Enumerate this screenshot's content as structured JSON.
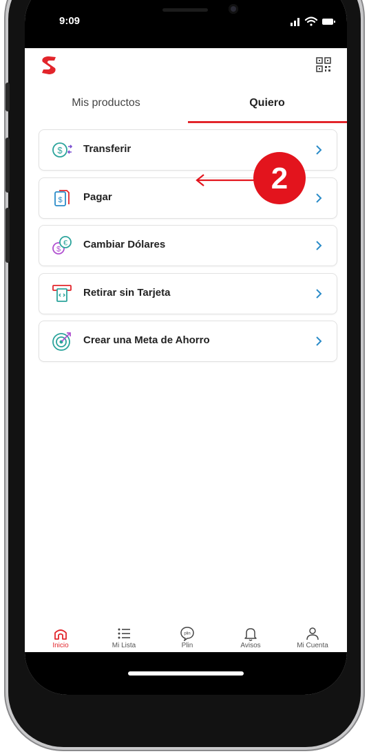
{
  "status_bar": {
    "time": "9:09"
  },
  "tabs": [
    {
      "label": "Mis productos",
      "active": false
    },
    {
      "label": "Quiero",
      "active": true
    }
  ],
  "accent_color": "#e2252b",
  "list": [
    {
      "label": "Transferir",
      "icon": "transfer-dollar-icon"
    },
    {
      "label": "Pagar",
      "icon": "pay-document-icon"
    },
    {
      "label": "Cambiar Dólares",
      "icon": "currency-exchange-icon"
    },
    {
      "label": "Retirar sin Tarjeta",
      "icon": "atm-withdraw-icon"
    },
    {
      "label": "Crear una Meta de Ahorro",
      "icon": "target-goal-icon"
    }
  ],
  "annotation": {
    "step_number": "2",
    "color": "#e3141d"
  },
  "bottom_nav": [
    {
      "label": "Inicio",
      "icon": "home-icon",
      "active": true
    },
    {
      "label": "Mi Lista",
      "icon": "list-icon",
      "active": false
    },
    {
      "label": "Plin",
      "icon": "plin-icon",
      "active": false
    },
    {
      "label": "Avisos",
      "icon": "bell-icon",
      "active": false
    },
    {
      "label": "Mi Cuenta",
      "icon": "user-icon",
      "active": false
    }
  ]
}
